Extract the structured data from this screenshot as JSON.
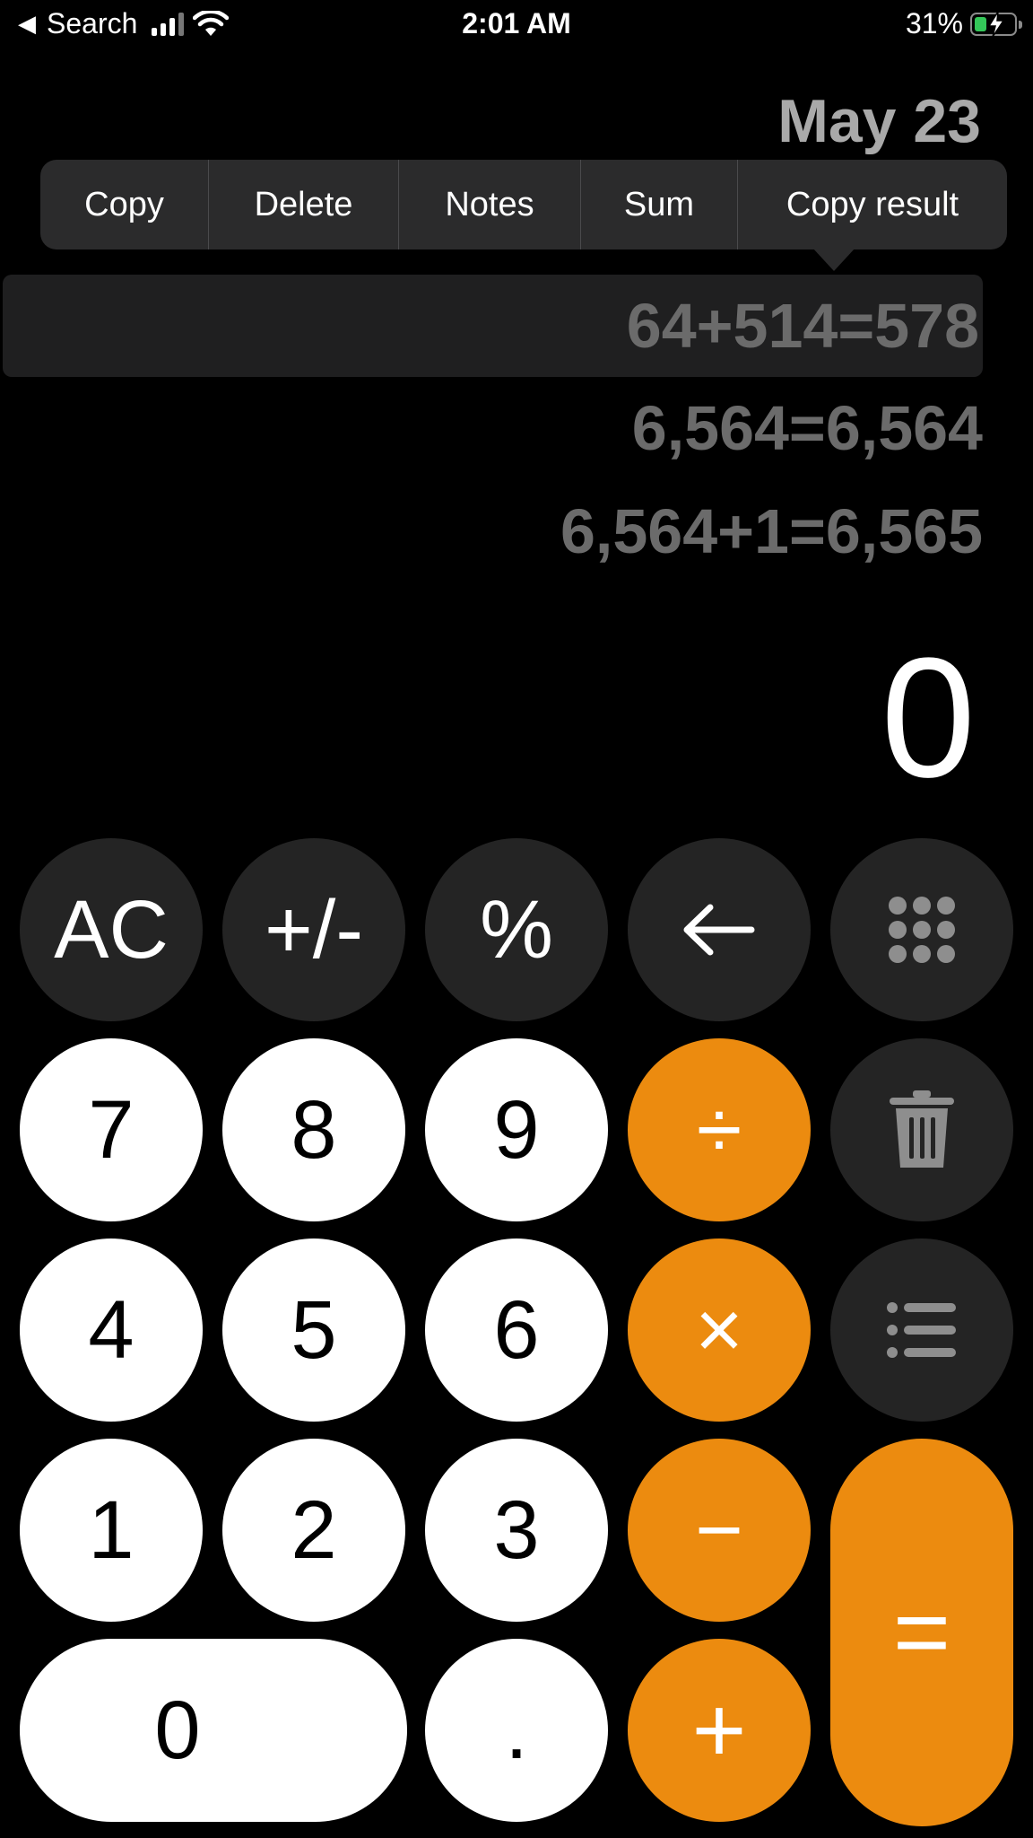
{
  "status_bar": {
    "back_label": "Search",
    "time": "2:01 AM",
    "battery": "31%",
    "battery_level": 0.31
  },
  "history": {
    "date": "May 23",
    "entries": [
      "64+514=578",
      "6,564=6,564",
      "6,564+1=6,565"
    ]
  },
  "context_menu": {
    "items": [
      "Copy",
      "Delete",
      "Notes",
      "Sum",
      "Copy result"
    ]
  },
  "display": {
    "value": "0"
  },
  "keypad": {
    "ac": "AC",
    "plus_minus": "+/-",
    "percent": "%",
    "backspace": "←",
    "seven": "7",
    "eight": "8",
    "nine": "9",
    "divide": "÷",
    "four": "4",
    "five": "5",
    "six": "6",
    "multiply": "×",
    "one": "1",
    "two": "2",
    "three": "3",
    "minus": "−",
    "zero": "0",
    "decimal": ".",
    "plus": "+",
    "equals": "="
  },
  "colors": {
    "orange": "#ec8b0f",
    "dark_key": "#242424",
    "light_key": "#ffffff",
    "history_text": "#6b6b6b"
  }
}
